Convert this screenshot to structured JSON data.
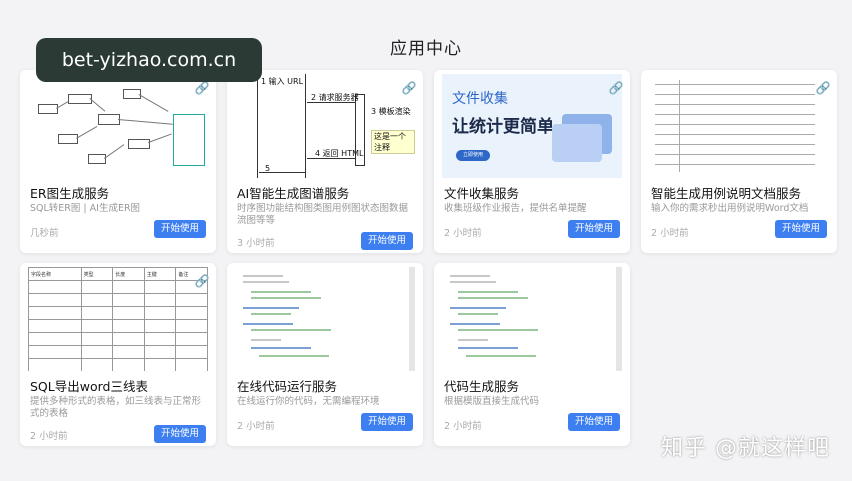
{
  "page": {
    "title": "应用中心"
  },
  "watermark": {
    "text": "bet-yizhao.com.cn"
  },
  "footer": {
    "brand": "知乎 @就这样吧"
  },
  "cards": [
    {
      "title": "ER图生成服务",
      "desc": "SQL转ER图 | AI生成ER图",
      "time": "几秒前",
      "button": "开始使用"
    },
    {
      "title": "AI智能生成图谱服务",
      "desc": "时序图功能结构图类图用例图状态图数据流图等等",
      "time": "3 小时前",
      "button": "开始使用",
      "thumb": {
        "steps": [
          "1 输入 URL",
          "2 请求服务器",
          "3 模板渲染",
          "这是一个注释",
          "4 返回 HTML",
          "5"
        ]
      }
    },
    {
      "title": "文件收集服务",
      "desc": "收集班级作业报告，提供名单提醒",
      "time": "2 小时前",
      "button": "开始使用",
      "thumb": {
        "headline": "文件收集",
        "tagline": "让统计更简单",
        "cta": "立即使用"
      }
    },
    {
      "title": "智能生成用例说明文档服务",
      "desc": "输入你的需求秒出用例说明Word文档",
      "time": "2 小时前",
      "button": "开始使用"
    },
    {
      "title": "SQL导出word三线表",
      "desc": "提供多种形式的表格，如三线表与正常形式的表格",
      "time": "2 小时前",
      "button": "开始使用",
      "thumb": {
        "headers": [
          "字段名称",
          "类型",
          "长度",
          "主键",
          "备注"
        ]
      }
    },
    {
      "title": "在线代码运行服务",
      "desc": "在线运行你的代码，无需编程环境",
      "time": "2 小时前",
      "button": "开始使用"
    },
    {
      "title": "代码生成服务",
      "desc": "根据模版直接生成代码",
      "time": "2 小时前",
      "button": "开始使用"
    }
  ],
  "colors": {
    "accent": "#3d7ff0",
    "background": "#f3f3f5"
  }
}
